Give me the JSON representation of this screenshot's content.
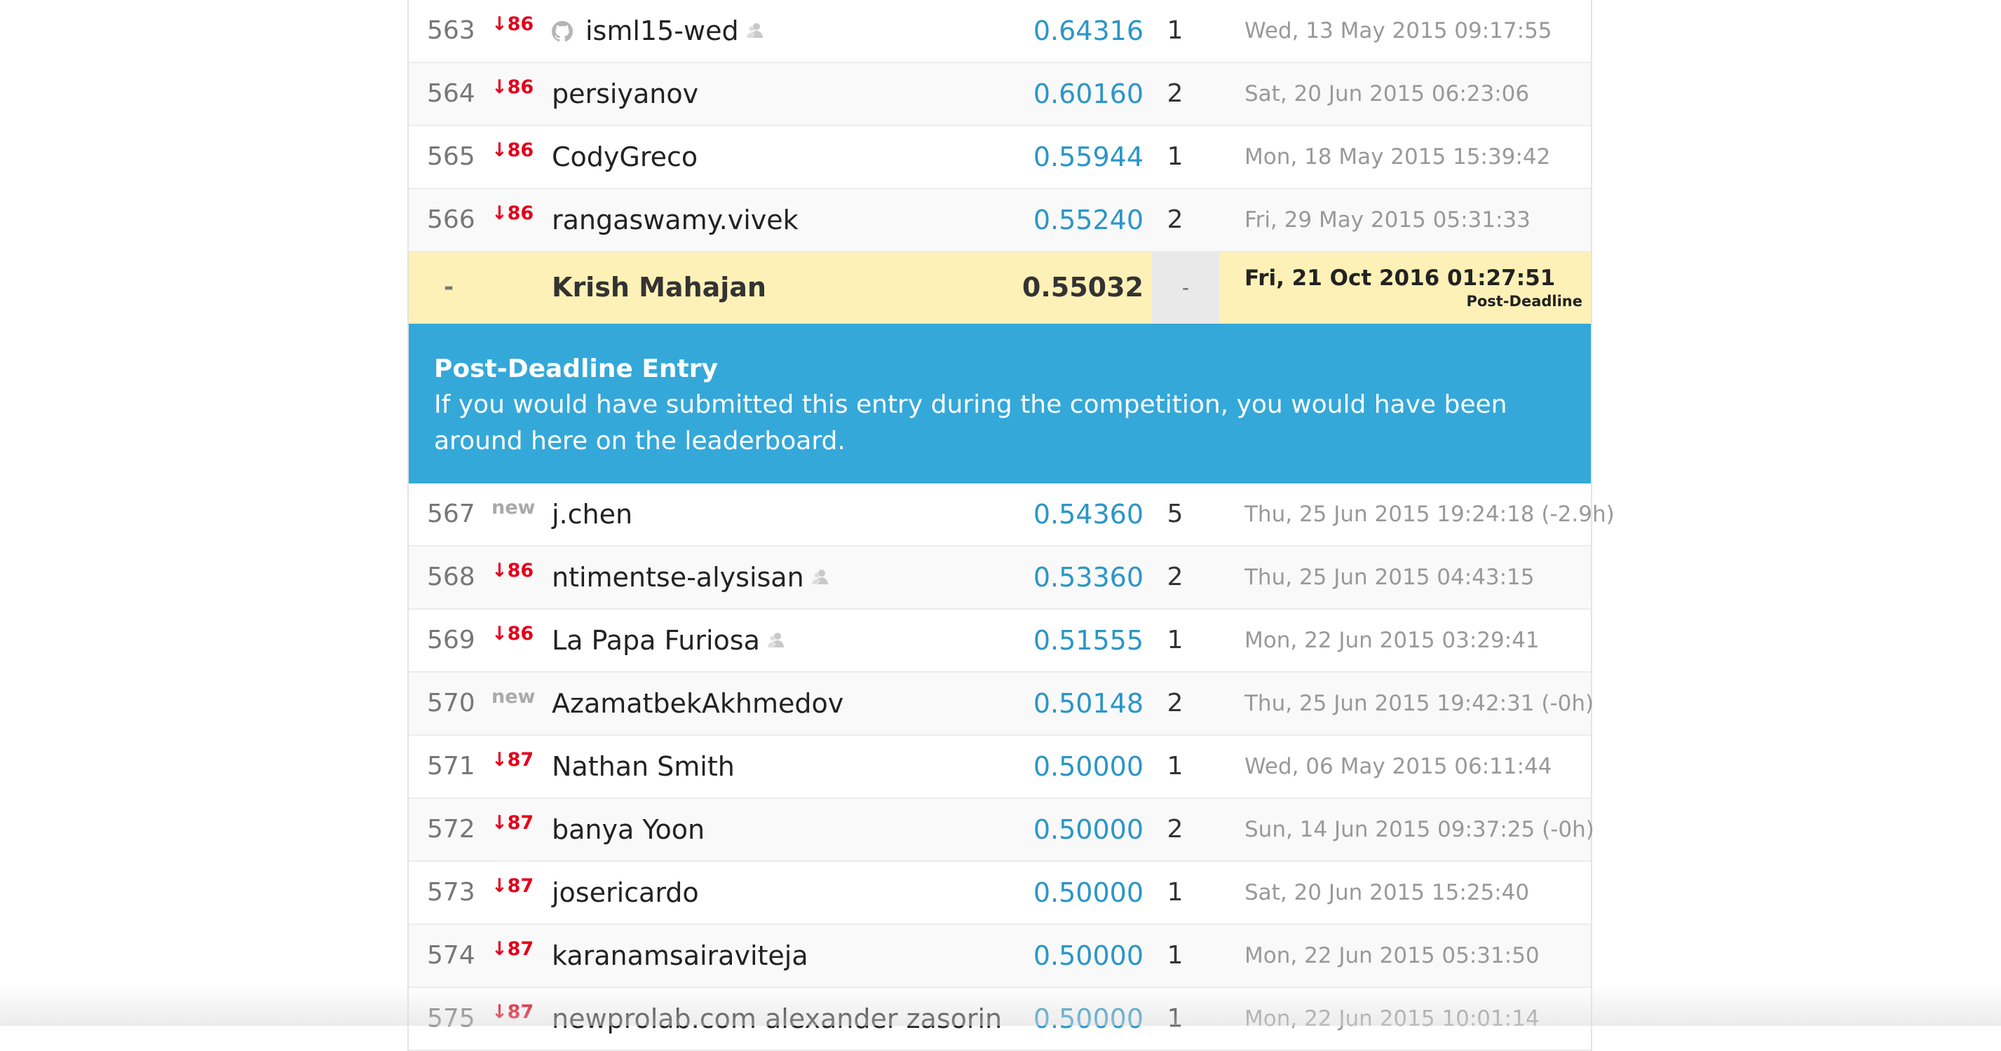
{
  "leaderboard": {
    "rows_before": [
      {
        "rank": "563",
        "delta": "↓86",
        "delta_type": "down",
        "team": "isml15-wed",
        "github": true,
        "team_member": true,
        "score": "0.64316",
        "entries": "1",
        "last": "Wed, 13 May 2015 09:17:55"
      },
      {
        "rank": "564",
        "delta": "↓86",
        "delta_type": "down",
        "team": "persiyanov",
        "github": false,
        "team_member": false,
        "score": "0.60160",
        "entries": "2",
        "last": "Sat, 20 Jun 2015 06:23:06"
      },
      {
        "rank": "565",
        "delta": "↓86",
        "delta_type": "down",
        "team": "CodyGreco",
        "github": false,
        "team_member": false,
        "score": "0.55944",
        "entries": "1",
        "last": "Mon, 18 May 2015 15:39:42"
      },
      {
        "rank": "566",
        "delta": "↓86",
        "delta_type": "down",
        "team": "rangaswamy.vivek",
        "github": false,
        "team_member": false,
        "score": "0.55240",
        "entries": "2",
        "last": "Fri, 29 May 2015 05:31:33"
      }
    ],
    "my_entry": {
      "rank": "-",
      "team": "Krish Mahajan",
      "score": "0.55032",
      "entries": "-",
      "last": "Fri, 21 Oct 2016 01:27:51",
      "badge": "Post-Deadline"
    },
    "banner": {
      "title": "Post-Deadline Entry",
      "text": "If you would have submitted this entry during the competition, you would have been around here on the leaderboard."
    },
    "rows_after": [
      {
        "rank": "567",
        "delta": "new",
        "delta_type": "new",
        "team": "j.chen",
        "github": false,
        "team_member": false,
        "score": "0.54360",
        "entries": "5",
        "last": "Thu, 25 Jun 2015 19:24:18 (-2.9h)"
      },
      {
        "rank": "568",
        "delta": "↓86",
        "delta_type": "down",
        "team": "ntimentse-alysisan",
        "github": false,
        "team_member": true,
        "score": "0.53360",
        "entries": "2",
        "last": "Thu, 25 Jun 2015 04:43:15"
      },
      {
        "rank": "569",
        "delta": "↓86",
        "delta_type": "down",
        "team": "La Papa Furiosa",
        "github": false,
        "team_member": true,
        "score": "0.51555",
        "entries": "1",
        "last": "Mon, 22 Jun 2015 03:29:41"
      },
      {
        "rank": "570",
        "delta": "new",
        "delta_type": "new",
        "team": "AzamatbekAkhmedov",
        "github": false,
        "team_member": false,
        "score": "0.50148",
        "entries": "2",
        "last": "Thu, 25 Jun 2015 19:42:31 (-0h)"
      },
      {
        "rank": "571",
        "delta": "↓87",
        "delta_type": "down",
        "team": "Nathan Smith",
        "github": false,
        "team_member": false,
        "score": "0.50000",
        "entries": "1",
        "last": "Wed, 06 May 2015 06:11:44"
      },
      {
        "rank": "572",
        "delta": "↓87",
        "delta_type": "down",
        "team": "banya Yoon",
        "github": false,
        "team_member": false,
        "score": "0.50000",
        "entries": "2",
        "last": "Sun, 14 Jun 2015 09:37:25 (-0h)"
      },
      {
        "rank": "573",
        "delta": "↓87",
        "delta_type": "down",
        "team": "josericardo",
        "github": false,
        "team_member": false,
        "score": "0.50000",
        "entries": "1",
        "last": "Sat, 20 Jun 2015 15:25:40"
      },
      {
        "rank": "574",
        "delta": "↓87",
        "delta_type": "down",
        "team": "karanamsairaviteja",
        "github": false,
        "team_member": false,
        "score": "0.50000",
        "entries": "1",
        "last": "Mon, 22 Jun 2015 05:31:50"
      },
      {
        "rank": "575",
        "delta": "↓87",
        "delta_type": "down",
        "team": "newprolab.com alexander zasorin",
        "github": false,
        "team_member": false,
        "score": "0.50000",
        "entries": "1",
        "last": "Mon, 22 Jun 2015 10:01:14"
      }
    ]
  },
  "icons": {
    "github": "github-icon",
    "team_member": "team-member-icon"
  },
  "colors": {
    "score": "#2b96c7",
    "delta_down": "#e3001b",
    "highlight_row": "#fef1b7",
    "banner": "#34a8d9"
  }
}
